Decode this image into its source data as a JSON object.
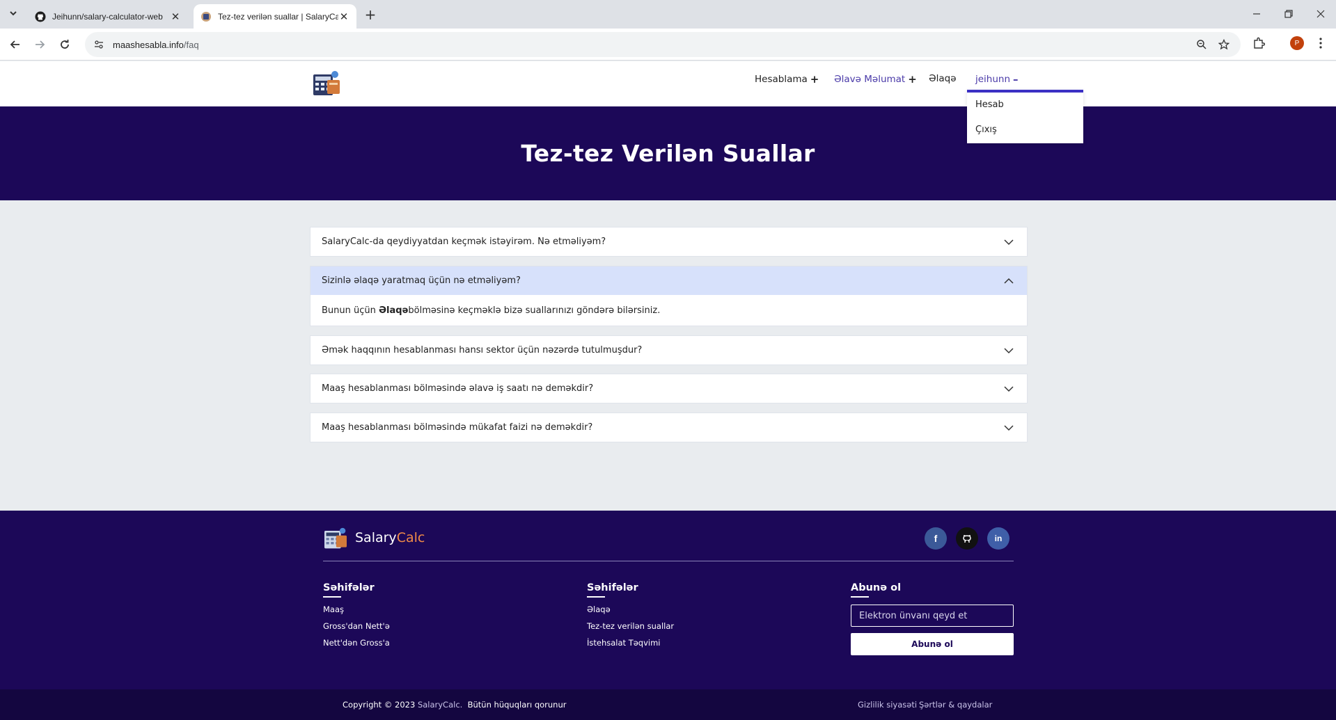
{
  "browser": {
    "tabs": [
      {
        "title": "Jeihunn/salary-calculator-web",
        "favicon": "github-icon",
        "active": false
      },
      {
        "title": "Tez-tez verilən suallar | SalaryCalc",
        "favicon": "salarycalc-favicon",
        "active": true
      }
    ],
    "url_host": "maashesabla.info",
    "url_path": "/faq",
    "profile_initial": "P"
  },
  "header": {
    "nav": {
      "calc": "Hesablama",
      "more_info": "Əlavə Məlumat",
      "contact": "Əlaqə",
      "user": "jeihunn"
    },
    "user_menu": {
      "account": "Hesab",
      "logout": "Çıxış"
    }
  },
  "hero": {
    "title": "Tez-tez Verilən Suallar"
  },
  "faq": {
    "items": [
      {
        "question": "SalaryCalc-da qeydiyyatdan keçmək istəyirəm. Nə etməliyəm?",
        "expanded": false
      },
      {
        "question": "Sizinlə əlaqə yaratmaq üçün nə etməliyəm?",
        "expanded": true,
        "answer_prefix": "Bunun üçün ",
        "answer_bold": "Əlaqə",
        "answer_suffix": " bölməsinə keçməklə bizə suallarınızı göndərə bilərsiniz."
      },
      {
        "question": "Əmək haqqının hesablanması hansı sektor üçün nəzərdə tutulmuşdur?",
        "expanded": false
      },
      {
        "question": "Maaş hesablanması bölməsində əlavə iş saatı nə deməkdir?",
        "expanded": false
      },
      {
        "question": "Maaş hesablanması bölməsində mükafat faizi nə deməkdir?",
        "expanded": false
      }
    ]
  },
  "footer": {
    "brand_part1": "Salary",
    "brand_part2": "Calc",
    "col1": {
      "heading": "Səhifələr",
      "links": [
        "Maaş",
        "Gross'dan Nett'ə",
        "Nett'dən Gross'a"
      ]
    },
    "col2": {
      "heading": "Səhifələr",
      "links": [
        "Əlaqə",
        "Tez-tez verilən suallar",
        "İstehsalat Təqvimi"
      ]
    },
    "subscribe": {
      "heading": "Abunə ol",
      "placeholder": "Elektron ünvanı qeyd et",
      "button": "Abunə ol"
    },
    "social": [
      "facebook-icon",
      "github-icon",
      "linkedin-icon"
    ],
    "copyright_prefix": "Copyright © 2023",
    "copyright_brand": "SalaryCalc.",
    "copyright_suffix": "Bütün hüquqları qorunur",
    "privacy": "Gizlilik siyasəti",
    "terms": "Şərtlər & qaydalar"
  },
  "colors": {
    "brand_navy": "#1c0858",
    "accent_orange": "#f08a48",
    "expanded_faq_bg": "#d7e1fb",
    "dropdown_accent": "#3b30c4"
  }
}
